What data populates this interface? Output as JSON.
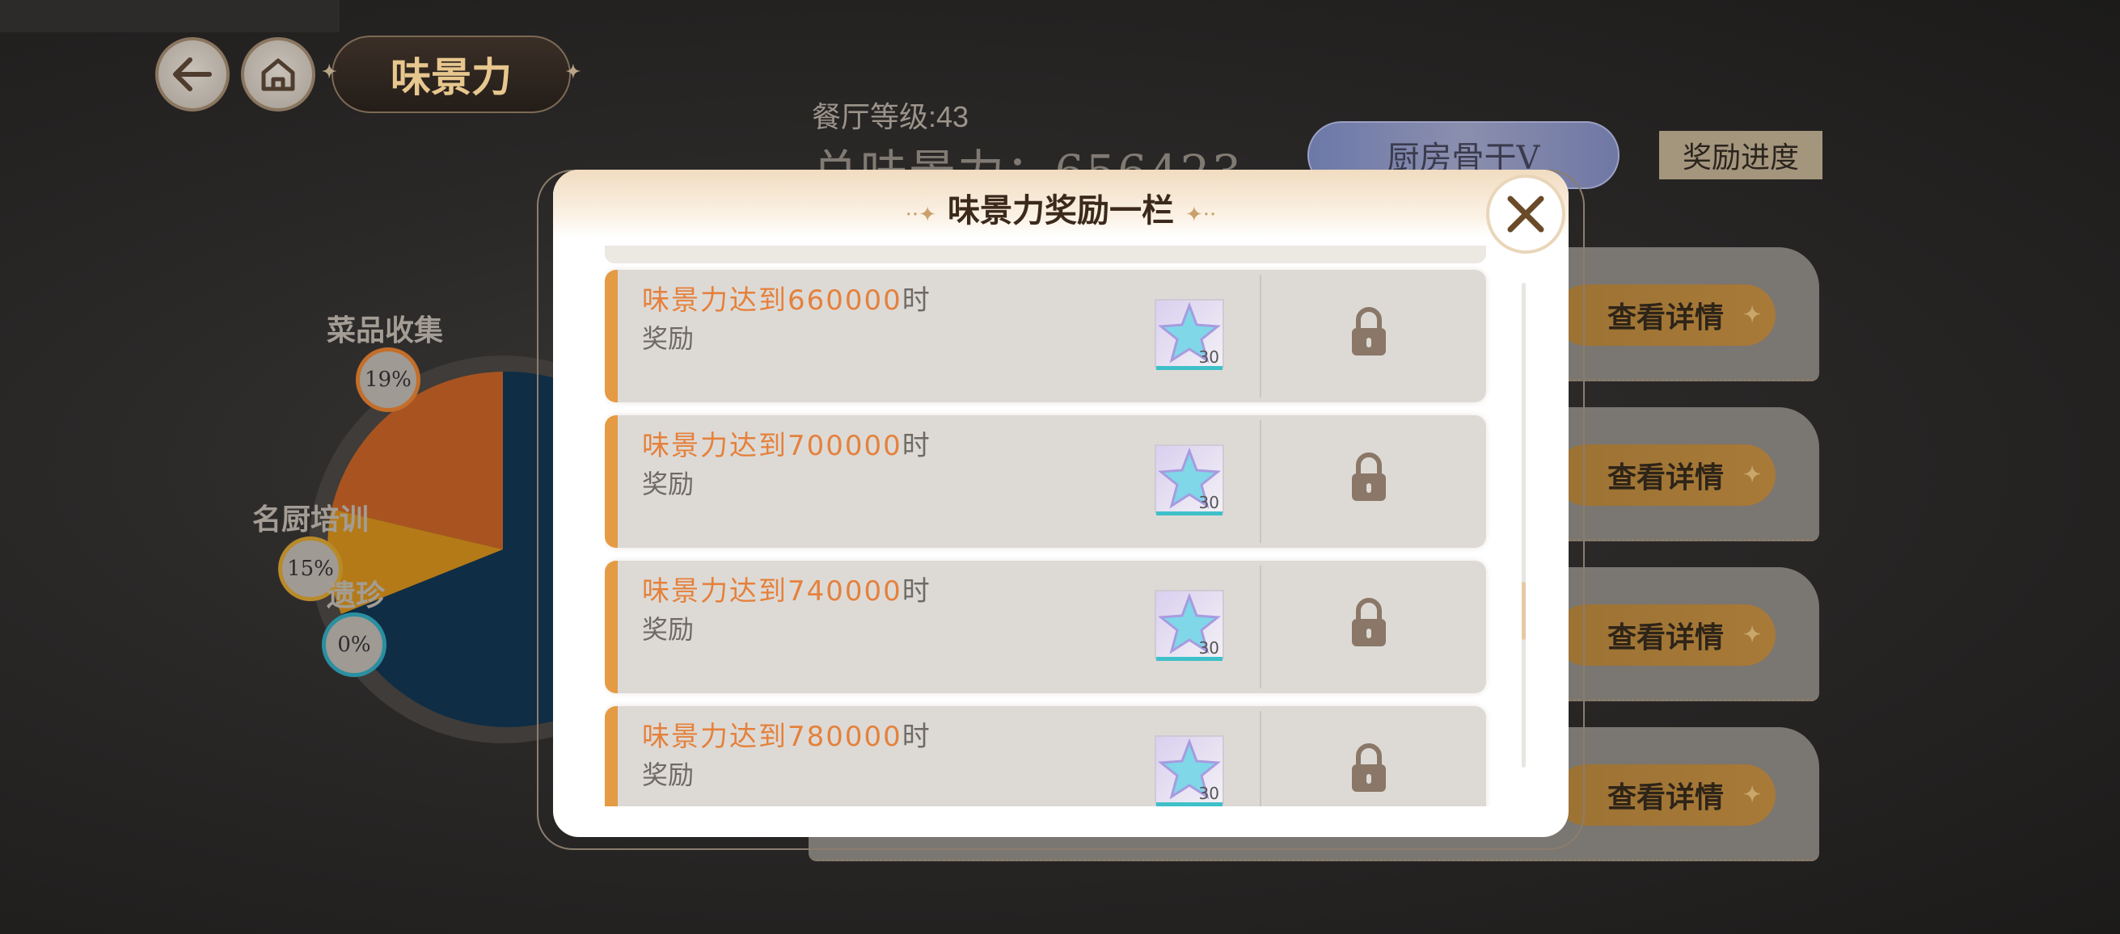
{
  "header": {
    "page_title": "味景力",
    "restaurant_level": "餐厅等级:43",
    "total_score": "总味景力：656423",
    "chef_title": "厨房骨干Ⅴ",
    "progress_button": "奖励进度"
  },
  "categories": [
    {
      "label": "菜品收集",
      "percent": "19%"
    },
    {
      "label": "名厨培训",
      "percent": "15%"
    },
    {
      "label": "遗珍",
      "percent": "0%"
    }
  ],
  "side_cards": {
    "detail_button": "查看详情"
  },
  "modal": {
    "title": "味景力奖励一栏",
    "rows": [
      {
        "condition_value": "味景力达到660000",
        "condition_suffix": "时",
        "label": "奖励",
        "item_icon": "crystal-star-icon",
        "quantity": "30",
        "status_icon": "lock-icon"
      },
      {
        "condition_value": "味景力达到700000",
        "condition_suffix": "时",
        "label": "奖励",
        "item_icon": "crystal-star-icon",
        "quantity": "30",
        "status_icon": "lock-icon"
      },
      {
        "condition_value": "味景力达到740000",
        "condition_suffix": "时",
        "label": "奖励",
        "item_icon": "crystal-star-icon",
        "quantity": "30",
        "status_icon": "lock-icon"
      },
      {
        "condition_value": "味景力达到780000",
        "condition_suffix": "时",
        "label": "奖励",
        "item_icon": "crystal-star-icon",
        "quantity": "30",
        "status_icon": "lock-icon"
      }
    ]
  },
  "colors": {
    "accent_orange": "#e5813c",
    "row_accent": "#e59b43",
    "gold_text": "#e7c78e",
    "pie_navy": "#0f2d45",
    "pie_orange": "#a95420",
    "pie_gold": "#b47a17"
  }
}
